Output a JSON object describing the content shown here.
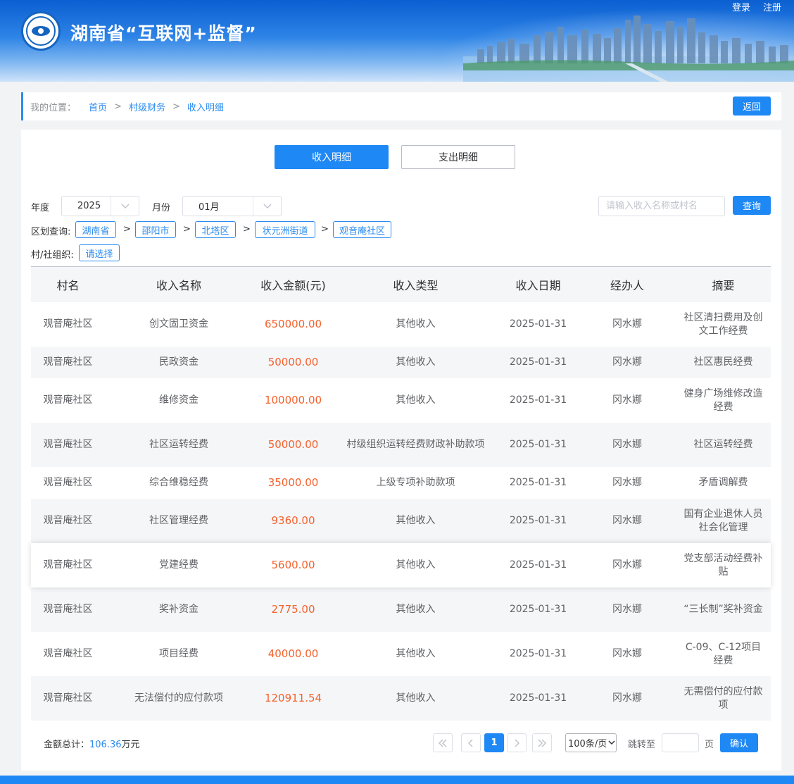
{
  "header": {
    "title": "湖南省“互联网+监督”",
    "login": "登录",
    "register": "注册"
  },
  "breadcrumb": {
    "label": "我的位置：",
    "items": [
      "首页",
      "村级财务",
      "收入明细"
    ],
    "separator": ">",
    "back": "返回"
  },
  "tabs": {
    "income": "收入明细",
    "expense": "支出明细"
  },
  "filters": {
    "year_label": "年度",
    "year_value": "2025",
    "month_label": "月份",
    "month_value": "01月",
    "search_placeholder": "请输入收入名称或村名",
    "query": "查询",
    "region_label": "区划查询:",
    "regions": [
      "湖南省",
      "邵阳市",
      "北塔区",
      "状元洲街道",
      "观音庵社区"
    ],
    "org_label": "村/社组织:",
    "org_value": "请选择"
  },
  "table": {
    "headers": [
      "村名",
      "收入名称",
      "收入金额(元)",
      "收入类型",
      "收入日期",
      "经办人",
      "摘要"
    ],
    "rows": [
      [
        "观音庵社区",
        "创文固卫资金",
        "650000.00",
        "其他收入",
        "2025-01-31",
        "冈水娜",
        "社区清扫费用及创文工作经费"
      ],
      [
        "观音庵社区",
        "民政资金",
        "50000.00",
        "其他收入",
        "2025-01-31",
        "冈水娜",
        "社区惠民经费"
      ],
      [
        "观音庵社区",
        "维修资金",
        "100000.00",
        "其他收入",
        "2025-01-31",
        "冈水娜",
        "健身广场维修改造经费"
      ],
      [
        "观音庵社区",
        "社区运转经费",
        "50000.00",
        "村级组织运转经费财政补助款项",
        "2025-01-31",
        "冈水娜",
        "社区运转经费"
      ],
      [
        "观音庵社区",
        "综合维稳经费",
        "35000.00",
        "上级专项补助款项",
        "2025-01-31",
        "冈水娜",
        "矛盾调解费"
      ],
      [
        "观音庵社区",
        "社区管理经费",
        "9360.00",
        "其他收入",
        "2025-01-31",
        "冈水娜",
        "国有企业退休人员社会化管理"
      ],
      [
        "观音庵社区",
        "党建经费",
        "5600.00",
        "其他收入",
        "2025-01-31",
        "冈水娜",
        "党支部活动经费补贴"
      ],
      [
        "观音庵社区",
        "奖补资金",
        "2775.00",
        "其他收入",
        "2025-01-31",
        "冈水娜",
        "“三长制”奖补资金"
      ],
      [
        "观音庵社区",
        "项目经费",
        "40000.00",
        "其他收入",
        "2025-01-31",
        "冈水娜",
        "C-09、C-12项目经费"
      ],
      [
        "观音庵社区",
        "无法偿付的应付款项",
        "120911.54",
        "其他收入",
        "2025-01-31",
        "冈水娜",
        "无需偿付的应付款项"
      ]
    ]
  },
  "footer": {
    "total_label": "金额总计：",
    "total_value": "106.36",
    "total_unit": "万元",
    "current_page": "1",
    "page_size": "100条/页",
    "jump_label": "跳转至",
    "page_unit": "页",
    "confirm": "确认"
  },
  "colors": {
    "primary": "#1e88f5",
    "amount": "#f5612d"
  }
}
